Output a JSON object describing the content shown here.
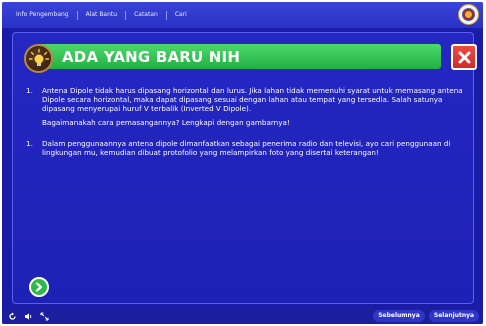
{
  "nav": {
    "items": [
      "Info Pengembang",
      "Alat Bantu",
      "Catatan",
      "Cari"
    ]
  },
  "header": {
    "title": "ADA YANG BARU NIH"
  },
  "content": {
    "item1": {
      "number": "1.",
      "text": "Antena Dipole tidak harus dipasang horizontal dan lurus. Jika lahan tidak memenuhi syarat untuk memasang antena Dipole secara horizontal, maka dapat dipasang sesuai dengan lahan atau tempat yang tersedia. Salah satunya dipasang menyerupai huruf V terbalik (Inverted V Dipole).",
      "question": "Bagaimanakah cara pemasangannya? Lengkapi dengan gambarnya!"
    },
    "item2": {
      "number": "1.",
      "text": "Dalam penggunaannya antena dipole dimanfaatkan sebagai penerima radio dan televisi, ayo cari penggunaan di lingkungan mu, kemudian dibuat protofolio yang melampirkan foto yang disertai keterangan!"
    }
  },
  "footer": {
    "prev_label": "Sebelumnya",
    "next_label": "Selanjutnya"
  },
  "colors": {
    "background": "#1a1ca8",
    "title_bar": "#22b043",
    "close": "#cf2a25"
  }
}
